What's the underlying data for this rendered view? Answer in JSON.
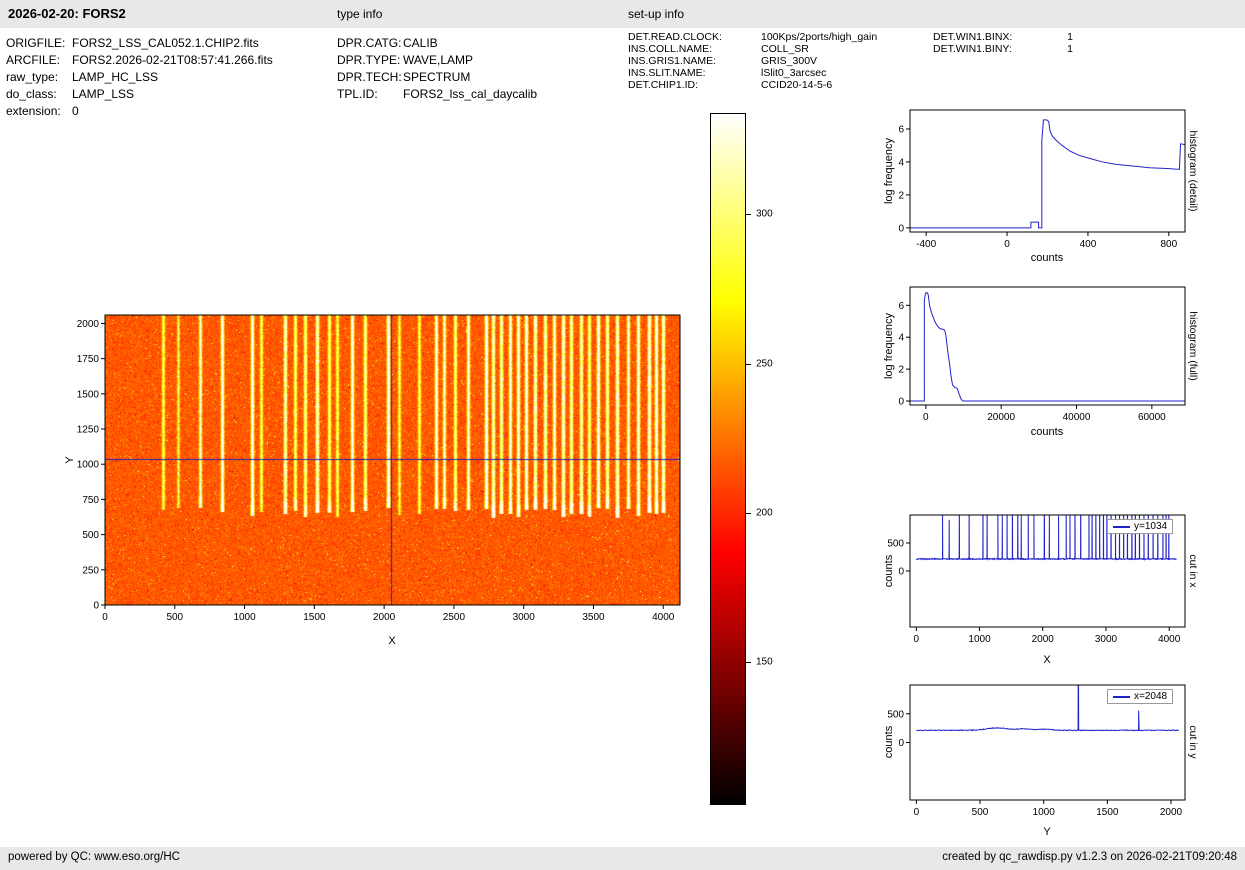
{
  "header": {
    "title": "2026-02-20: FORS2",
    "type_info_label": "type info",
    "setup_info_label": "set-up info"
  },
  "file_info": {
    "rows": [
      {
        "label": "ORIGFILE:",
        "value": "FORS2_LSS_CAL052.1.CHIP2.fits"
      },
      {
        "label": "ARCFILE:",
        "value": "FORS2.2026-02-21T08:57:41.266.fits"
      },
      {
        "label": "raw_type:",
        "value": "LAMP_HC_LSS"
      },
      {
        "label": "do_class:",
        "value": "LAMP_LSS"
      },
      {
        "label": "extension:",
        "value": "0"
      }
    ]
  },
  "type_info": {
    "rows": [
      {
        "label": "DPR.CATG:",
        "value": "CALIB"
      },
      {
        "label": "DPR.TYPE:",
        "value": "WAVE,LAMP"
      },
      {
        "label": "DPR.TECH:",
        "value": "SPECTRUM"
      },
      {
        "label": "TPL.ID:",
        "value": "FORS2_lss_cal_daycalib"
      }
    ]
  },
  "setup_info": {
    "rows": [
      {
        "label": "DET.READ.CLOCK:",
        "value": "100Kps/2ports/high_gain"
      },
      {
        "label": "INS.COLL.NAME:",
        "value": "COLL_SR"
      },
      {
        "label": "INS.GRIS1.NAME:",
        "value": "GRIS_300V"
      },
      {
        "label": "INS.SLIT.NAME:",
        "value": "lSlit0_3arcsec"
      },
      {
        "label": "DET.CHIP1.ID:",
        "value": "CCID20-14-5-6"
      }
    ],
    "win_rows": [
      {
        "label": "DET.WIN1.BINX:",
        "value": "1"
      },
      {
        "label": "DET.WIN1.BINY:",
        "value": "1"
      }
    ]
  },
  "footer": {
    "left": "powered by QC: www.eso.org/HC",
    "right": "created by qc_rawdisp.py v1.2.3 on 2026-02-21T09:20:48"
  },
  "chart_data": [
    {
      "id": "raw_image",
      "type": "heatmap",
      "description": "FORS2 raw long-slit wavelength-calibration lamp frame: orange background around 210 counts with bright vertical arc emission lines above y~620, hot colormap, blue crosshair cursor",
      "xlabel": "X",
      "ylabel": "Y",
      "xlim": [
        0,
        4120
      ],
      "ylim": [
        0,
        2060
      ],
      "xticks": [
        0,
        500,
        1000,
        1500,
        2000,
        2500,
        3000,
        3500,
        4000
      ],
      "yticks": [
        0,
        250,
        500,
        750,
        1000,
        1250,
        1500,
        1750,
        2000
      ],
      "colormap": "hot",
      "background_counts": 210,
      "lines_y_extent": [
        620,
        2060
      ],
      "crosshair": {
        "x": 2048,
        "y": 1034,
        "color": "#2222bb"
      },
      "emission_lines": [
        [
          415,
          0.5
        ],
        [
          520,
          0.35
        ],
        [
          680,
          0.6
        ],
        [
          835,
          0.8
        ],
        [
          1055,
          0.9
        ],
        [
          1120,
          0.5
        ],
        [
          1290,
          0.85
        ],
        [
          1360,
          0.6
        ],
        [
          1435,
          0.7
        ],
        [
          1520,
          0.9
        ],
        [
          1605,
          0.6
        ],
        [
          1660,
          0.5
        ],
        [
          1770,
          0.8
        ],
        [
          1860,
          0.7
        ],
        [
          2025,
          1.0
        ],
        [
          2105,
          0.45
        ],
        [
          2250,
          0.5
        ],
        [
          2370,
          0.75
        ],
        [
          2430,
          0.6
        ],
        [
          2510,
          0.65
        ],
        [
          2600,
          0.7
        ],
        [
          2730,
          0.9
        ],
        [
          2780,
          0.85
        ],
        [
          2840,
          0.8
        ],
        [
          2900,
          0.75
        ],
        [
          2960,
          0.8
        ],
        [
          3015,
          0.85
        ],
        [
          3080,
          0.9
        ],
        [
          3150,
          0.85
        ],
        [
          3215,
          0.8
        ],
        [
          3280,
          0.95
        ],
        [
          3340,
          0.8
        ],
        [
          3410,
          0.85
        ],
        [
          3465,
          0.7
        ],
        [
          3530,
          0.9
        ],
        [
          3600,
          0.8
        ],
        [
          3670,
          0.95
        ],
        [
          3745,
          0.7
        ],
        [
          3820,
          0.85
        ],
        [
          3900,
          1.0
        ],
        [
          3950,
          0.8
        ],
        [
          3995,
          0.9
        ]
      ]
    },
    {
      "id": "colorbar",
      "type": "colorbar",
      "colormap": "hot",
      "range": [
        102,
        334
      ],
      "ticks": [
        150,
        200,
        250,
        300
      ]
    },
    {
      "id": "hist_detail",
      "type": "line",
      "right_label": "histogram (detail)",
      "xlabel": "counts",
      "ylabel": "log frequency",
      "xlim": [
        -480,
        880
      ],
      "ylim": [
        -0.25,
        7.15
      ],
      "xticks": [
        -400,
        0,
        400,
        800
      ],
      "yticks": [
        0,
        2,
        4,
        6
      ],
      "color": "#2222cc",
      "points": [
        [
          -480,
          0
        ],
        [
          118,
          0
        ],
        [
          118,
          0.35
        ],
        [
          156,
          0.35
        ],
        [
          156,
          0
        ],
        [
          172,
          0
        ],
        [
          172,
          5.3
        ],
        [
          180,
          6.55
        ],
        [
          196,
          6.55
        ],
        [
          206,
          6.45
        ],
        [
          212,
          5.9
        ],
        [
          224,
          5.55
        ],
        [
          244,
          5.3
        ],
        [
          272,
          5.0
        ],
        [
          312,
          4.65
        ],
        [
          356,
          4.4
        ],
        [
          412,
          4.2
        ],
        [
          472,
          4.0
        ],
        [
          540,
          3.85
        ],
        [
          620,
          3.75
        ],
        [
          704,
          3.65
        ],
        [
          790,
          3.6
        ],
        [
          852,
          3.55
        ],
        [
          858,
          5.1
        ],
        [
          880,
          5.05
        ]
      ]
    },
    {
      "id": "hist_full",
      "type": "line",
      "right_label": "histogram (full)",
      "xlabel": "counts",
      "ylabel": "log frequency",
      "xlim": [
        -4200,
        68800
      ],
      "ylim": [
        -0.25,
        7.15
      ],
      "xticks": [
        0,
        20000,
        40000,
        60000
      ],
      "yticks": [
        0,
        2,
        4,
        6
      ],
      "color": "#2222cc",
      "points": [
        [
          -4200,
          0
        ],
        [
          -400,
          0
        ],
        [
          -400,
          6.3
        ],
        [
          -100,
          6.75
        ],
        [
          300,
          6.8
        ],
        [
          600,
          6.7
        ],
        [
          800,
          6.35
        ],
        [
          1000,
          6.0
        ],
        [
          1250,
          5.75
        ],
        [
          1500,
          5.55
        ],
        [
          1800,
          5.35
        ],
        [
          2200,
          5.1
        ],
        [
          2600,
          4.9
        ],
        [
          3100,
          4.7
        ],
        [
          3700,
          4.55
        ],
        [
          4400,
          4.5
        ],
        [
          5000,
          4.45
        ],
        [
          5300,
          4.15
        ],
        [
          5600,
          3.55
        ],
        [
          5900,
          2.95
        ],
        [
          6300,
          2.35
        ],
        [
          6700,
          1.55
        ],
        [
          7100,
          1.0
        ],
        [
          7700,
          0.85
        ],
        [
          8300,
          0.8
        ],
        [
          8900,
          0.4
        ],
        [
          9400,
          0.1
        ],
        [
          9900,
          0
        ],
        [
          68800,
          0
        ]
      ]
    },
    {
      "id": "cut_x",
      "type": "line",
      "right_label": "cut in x",
      "xlabel": "X",
      "ylabel": "counts",
      "legend": "y=1034",
      "xlim": [
        -100,
        4250
      ],
      "ylim": [
        -1000,
        1000
      ],
      "xticks": [
        0,
        1000,
        2000,
        3000,
        4000
      ],
      "yticks": [
        0,
        500
      ],
      "color": "#2222cc",
      "baseline": 215,
      "noise": 9,
      "spike_base": 120,
      "spike_scale": 1600,
      "spikes_from_emission_lines": true
    },
    {
      "id": "cut_y",
      "type": "line",
      "right_label": "cut in y",
      "xlabel": "Y",
      "ylabel": "counts",
      "legend": "x=2048",
      "xlim": [
        -50,
        2110
      ],
      "ylim": [
        -1000,
        1000
      ],
      "xticks": [
        0,
        500,
        1000,
        1500,
        2000
      ],
      "yticks": [
        0,
        500
      ],
      "color": "#2222cc",
      "baseline": 212,
      "noise": 7,
      "bumps": [
        [
          630,
          42,
          80
        ],
        [
          845,
          26,
          55
        ],
        [
          1010,
          20,
          45
        ]
      ],
      "spikes": [
        [
          1272,
          2200
        ],
        [
          1746,
          345
        ]
      ]
    }
  ]
}
